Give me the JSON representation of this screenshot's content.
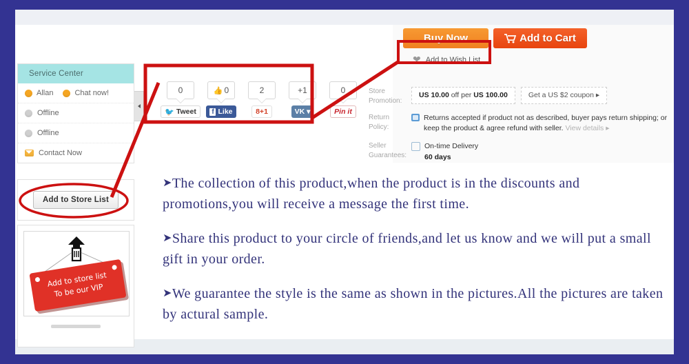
{
  "frame": {
    "border_color": "#333392"
  },
  "service_center": {
    "title": "Service Center",
    "agent1": "Allan",
    "agent2": "Chat now!",
    "offline1": "Offline",
    "offline2": "Offline",
    "contact": "Contact Now"
  },
  "store_list": {
    "button_label": "Add to Store List"
  },
  "vip_banner": {
    "line1": "Add to store list",
    "line2": "To be our VIP"
  },
  "social": {
    "items": [
      {
        "count": "0",
        "label": "Tweet",
        "icon": "twitter-icon"
      },
      {
        "count": "0",
        "label": "Like",
        "icon": "facebook-icon"
      },
      {
        "count": "2",
        "label": "8+1",
        "icon": "google-plus-icon"
      },
      {
        "count": "+1",
        "label": "VK",
        "icon": "vk-icon"
      },
      {
        "count": "0",
        "label": "Pin it",
        "icon": "pinterest-icon"
      }
    ]
  },
  "actions": {
    "buy_now": "Buy Now",
    "add_to_cart": "Add to Cart",
    "add_to_wish_list": "Add to Wish List"
  },
  "info": {
    "store_promotion_label": "Store\nPromotion:",
    "store_promotion_label_l1": "Store",
    "store_promotion_label_l2": "Promotion:",
    "promo_chip_1_pre": "US 10.00",
    "promo_chip_1_mid": " off per ",
    "promo_chip_1_post": "US 100.00",
    "promo_chip_2": "Get a US $2 coupon ▸",
    "return_policy_label": "Return Policy:",
    "return_policy_text": "Returns accepted if product not as described, buyer pays return shipping; or keep the product & agree refund with seller.",
    "return_policy_link": "View details ▸",
    "seller_guarantees_label_l1": "Seller",
    "seller_guarantees_label_l2": "Guarantees:",
    "delivery_title": "On-time Delivery",
    "delivery_days": "60 days"
  },
  "notes": {
    "arrow": "➤",
    "note1": "The collection of this product,when the product is in the discounts and promotions,you will receive a message the first time.",
    "note2": "Share this product to your circle of friends,and let us know and we will put a small gift in your order.",
    "note3": "We guarantee the style is the same as shown in the pictures.All the pictures are taken by actural sample."
  },
  "annotations": {
    "highlight_color": "#cc1111",
    "box_social": "red-box-social-share",
    "box_wishlist": "red-box-add-to-wish-list",
    "oval_store_list": "red-oval-add-to-store-list"
  }
}
